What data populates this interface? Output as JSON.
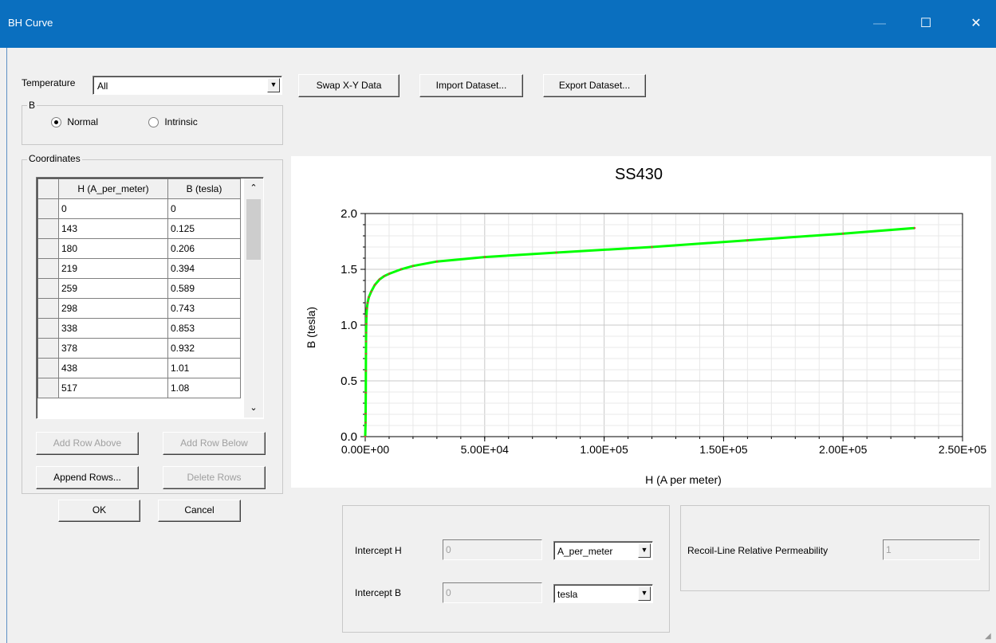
{
  "window": {
    "title": "BH Curve",
    "minimize": "—",
    "maximize": "☐",
    "close": "✕"
  },
  "temperature": {
    "label": "Temperature",
    "value": "All"
  },
  "b_group": {
    "label": "B",
    "normal": "Normal",
    "intrinsic": "Intrinsic",
    "selected": "Normal"
  },
  "toolbar": {
    "swap": "Swap X-Y Data",
    "import": "Import Dataset...",
    "export": "Export Dataset..."
  },
  "coordinates": {
    "label": "Coordinates",
    "col_h": "H (A_per_meter)",
    "col_b": "B (tesla)",
    "rows": [
      [
        "0",
        "0"
      ],
      [
        "143",
        "0.125"
      ],
      [
        "180",
        "0.206"
      ],
      [
        "219",
        "0.394"
      ],
      [
        "259",
        "0.589"
      ],
      [
        "298",
        "0.743"
      ],
      [
        "338",
        "0.853"
      ],
      [
        "378",
        "0.932"
      ],
      [
        "438",
        "1.01"
      ],
      [
        "517",
        "1.08"
      ]
    ]
  },
  "grid_buttons": {
    "add_above": "Add Row Above",
    "add_below": "Add Row Below",
    "append": "Append Rows...",
    "delete": "Delete Rows"
  },
  "dialog": {
    "ok": "OK",
    "cancel": "Cancel"
  },
  "intercepts": {
    "h_label": "Intercept H",
    "h_value": "0",
    "h_unit": "A_per_meter",
    "b_label": "Intercept B",
    "b_value": "0",
    "b_unit": "tesla"
  },
  "recoil": {
    "label": "Recoil-Line Relative Permeability",
    "value": "1"
  },
  "chart_data": {
    "type": "line",
    "title": "SS430",
    "xlabel": "H (A  per  meter)",
    "ylabel": "B (tesla)",
    "xlim": [
      0,
      250000
    ],
    "ylim": [
      0,
      2.0
    ],
    "xticks": [
      "0.00E+00",
      "5.00E+04",
      "1.00E+05",
      "1.50E+05",
      "2.00E+05",
      "2.50E+05"
    ],
    "yticks": [
      "0.0",
      "0.5",
      "1.0",
      "1.5",
      "2.0"
    ],
    "grid": true,
    "series": [
      {
        "color": "#00ff00",
        "x": [
          0,
          143,
          180,
          219,
          259,
          298,
          338,
          378,
          438,
          517,
          700,
          1000,
          1500,
          2500,
          4000,
          6000,
          8000,
          10000,
          15000,
          20000,
          30000,
          50000,
          80000,
          120000,
          160000,
          200000,
          230000
        ],
        "y": [
          0,
          0.125,
          0.206,
          0.394,
          0.589,
          0.743,
          0.853,
          0.932,
          1.01,
          1.08,
          1.15,
          1.2,
          1.25,
          1.3,
          1.36,
          1.41,
          1.44,
          1.46,
          1.5,
          1.53,
          1.57,
          1.61,
          1.65,
          1.7,
          1.76,
          1.82,
          1.87
        ]
      }
    ]
  }
}
